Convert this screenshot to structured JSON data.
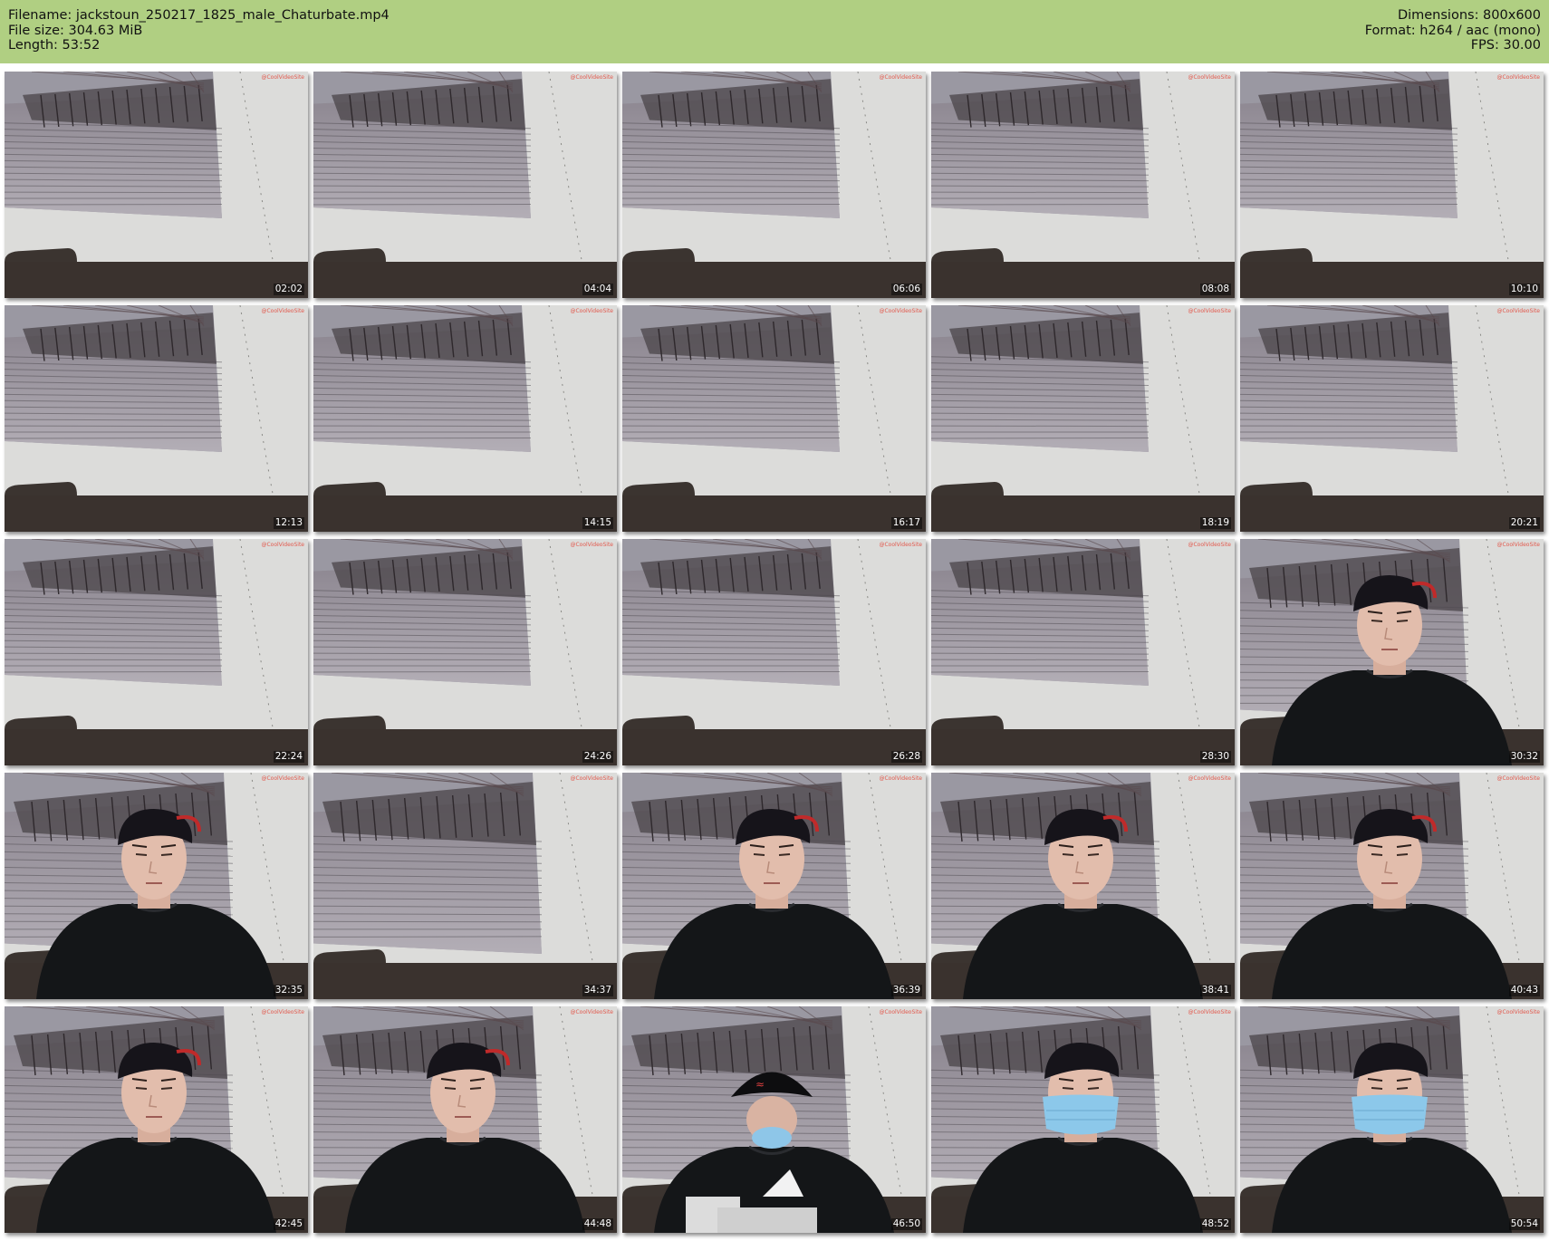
{
  "header": {
    "filename_line": "Filename: jackstoun_250217_1825_male_Chaturbate.mp4",
    "filesize_line": "File size: 304.63 MiB",
    "length_line": "Length: 53:52",
    "dimensions_line": "Dimensions: 800x600",
    "format_line": "Format: h264 / aac (mono)",
    "fps_line": "FPS: 30.00",
    "background_color": "#b0cf82"
  },
  "watermark": "@CoolVideoSite",
  "thumbnails": [
    {
      "time": "02:02",
      "scene": "empty"
    },
    {
      "time": "04:04",
      "scene": "empty"
    },
    {
      "time": "06:06",
      "scene": "empty"
    },
    {
      "time": "08:08",
      "scene": "empty"
    },
    {
      "time": "10:10",
      "scene": "empty"
    },
    {
      "time": "12:13",
      "scene": "empty"
    },
    {
      "time": "14:15",
      "scene": "empty"
    },
    {
      "time": "16:17",
      "scene": "empty"
    },
    {
      "time": "18:19",
      "scene": "empty"
    },
    {
      "time": "20:21",
      "scene": "empty"
    },
    {
      "time": "22:24",
      "scene": "empty"
    },
    {
      "time": "24:26",
      "scene": "empty"
    },
    {
      "time": "26:28",
      "scene": "empty"
    },
    {
      "time": "28:30",
      "scene": "empty"
    },
    {
      "time": "30:32",
      "scene": "person"
    },
    {
      "time": "32:35",
      "scene": "person"
    },
    {
      "time": "34:37",
      "scene": "empty-close"
    },
    {
      "time": "36:39",
      "scene": "person"
    },
    {
      "time": "38:41",
      "scene": "person"
    },
    {
      "time": "40:43",
      "scene": "person"
    },
    {
      "time": "42:45",
      "scene": "person"
    },
    {
      "time": "44:48",
      "scene": "person"
    },
    {
      "time": "46:50",
      "scene": "person-down-mask"
    },
    {
      "time": "48:52",
      "scene": "person-mask"
    },
    {
      "time": "50:54",
      "scene": "person-mask"
    }
  ]
}
